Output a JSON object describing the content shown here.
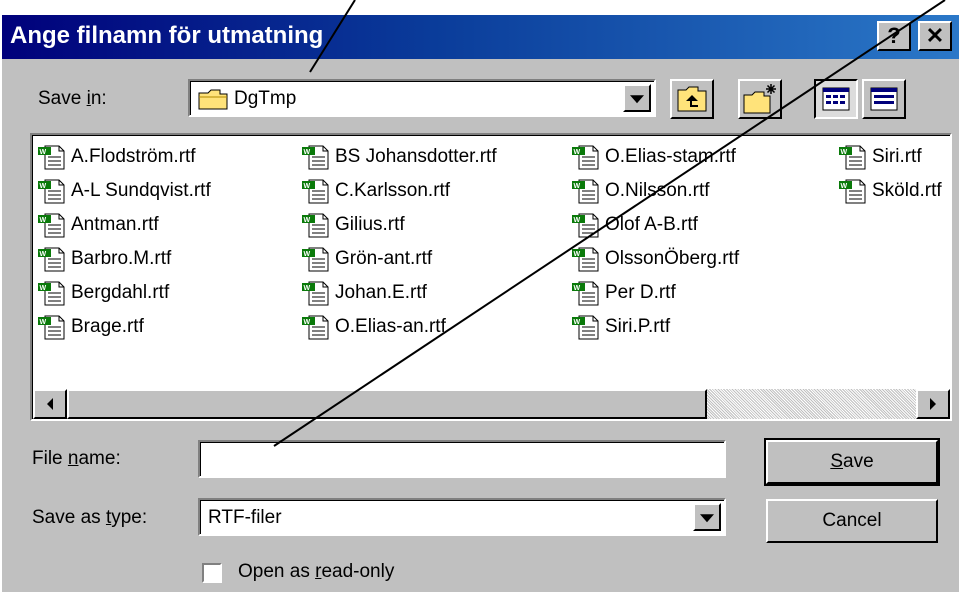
{
  "window": {
    "title": "Ange filnamn för utmatning",
    "help_label": "?",
    "close_label": "✕"
  },
  "save_in": {
    "label_pre": "Save ",
    "label_key": "i",
    "label_post": "n:",
    "value": "DgTmp"
  },
  "toolbar": {
    "icons": [
      "up-one-level-icon",
      "create-new-folder-icon",
      "list-view-icon",
      "details-view-icon"
    ]
  },
  "files": [
    "A.Flodström.rtf",
    "A-L Sundqvist.rtf",
    "Antman.rtf",
    "Barbro.M.rtf",
    "Bergdahl.rtf",
    "Brage.rtf",
    "BS Johansdotter.rtf",
    "C.Karlsson.rtf",
    "Gilius.rtf",
    "Grön-ant.rtf",
    "Johan.E.rtf",
    "O.Elias-an.rtf",
    "O.Elias-stam.rtf",
    "O.Nilsson.rtf",
    "Olof A-B.rtf",
    "OlssonÖberg.rtf",
    "Per D.rtf",
    "Siri.P.rtf",
    "Siri.rtf",
    "Sköld.rtf"
  ],
  "file_name": {
    "label_pre": "File ",
    "label_key": "n",
    "label_post": "ame:",
    "value": ""
  },
  "save_as_type": {
    "label_pre": "Save as ",
    "label_key": "t",
    "label_post": "ype:",
    "value": "RTF-filer"
  },
  "buttons": {
    "save_key": "S",
    "save_rest": "ave",
    "cancel": "Cancel"
  },
  "read_only": {
    "label_pre": "Open as ",
    "label_key": "r",
    "label_post": "ead-only",
    "checked": false
  },
  "colors": {
    "face": "#c0c0c0",
    "title_start": "#00007b",
    "title_end": "#2b78c8"
  }
}
